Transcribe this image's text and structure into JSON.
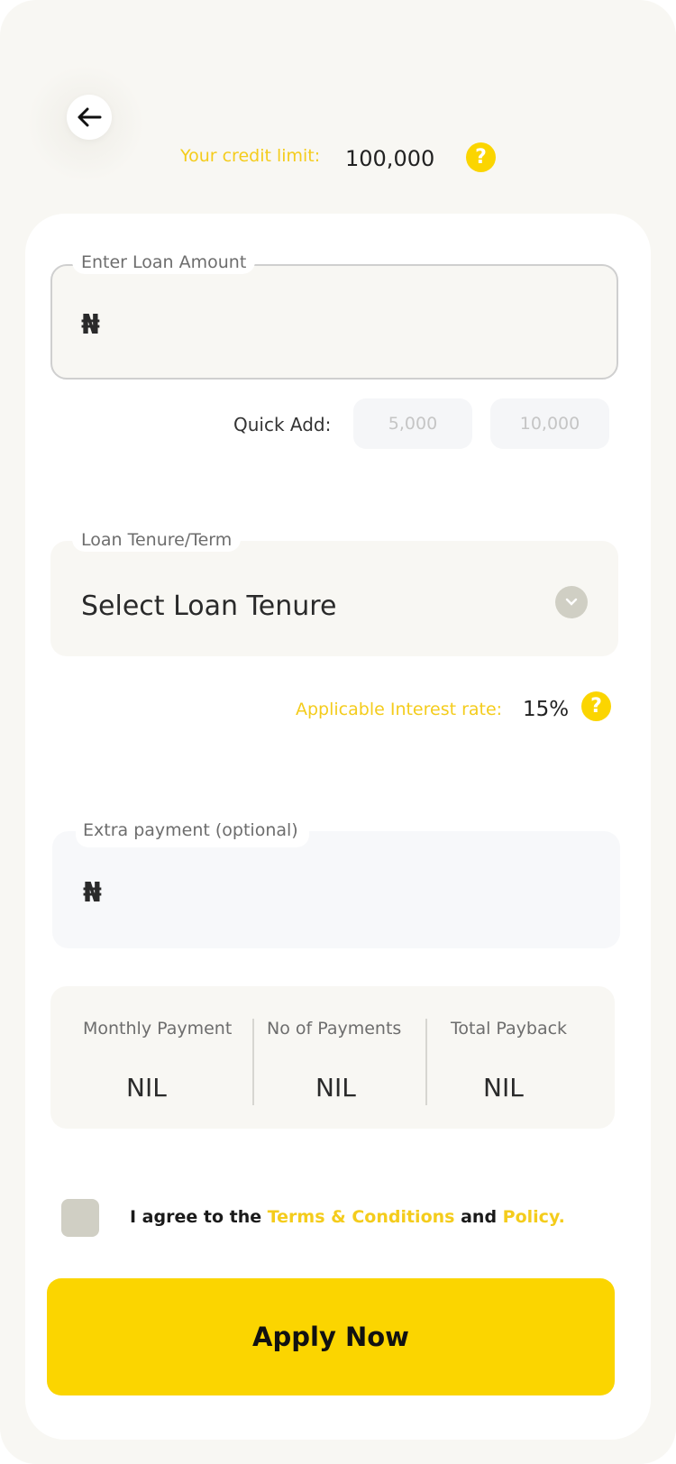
{
  "header": {
    "credit_limit_label": "Your credit limit:",
    "credit_limit_value": "100,000"
  },
  "loan_amount": {
    "label": "Enter Loan Amount",
    "currency_symbol": "₦",
    "value": ""
  },
  "quick_add": {
    "label": "Quick Add:",
    "options": [
      "5,000",
      "10,000"
    ]
  },
  "tenure": {
    "label": "Loan Tenure/Term",
    "placeholder": "Select Loan Tenure"
  },
  "interest": {
    "label": "Applicable Interest rate:",
    "value": "15%"
  },
  "extra_payment": {
    "label": "Extra payment (optional)",
    "currency_symbol": "₦"
  },
  "summary": {
    "columns": [
      {
        "label": "Monthly Payment",
        "value": "NIL"
      },
      {
        "label": "No of Payments",
        "value": "NIL"
      },
      {
        "label": "Total Payback",
        "value": "NIL"
      }
    ]
  },
  "agreement": {
    "prefix": "I agree to the",
    "terms_link": "Terms & Conditions",
    "conjunction": "and",
    "policy_link": "Policy."
  },
  "apply_button": "Apply Now",
  "colors": {
    "accent": "#fbd500",
    "accent_text": "#f4cc1c",
    "background": "#f8f7f3"
  }
}
